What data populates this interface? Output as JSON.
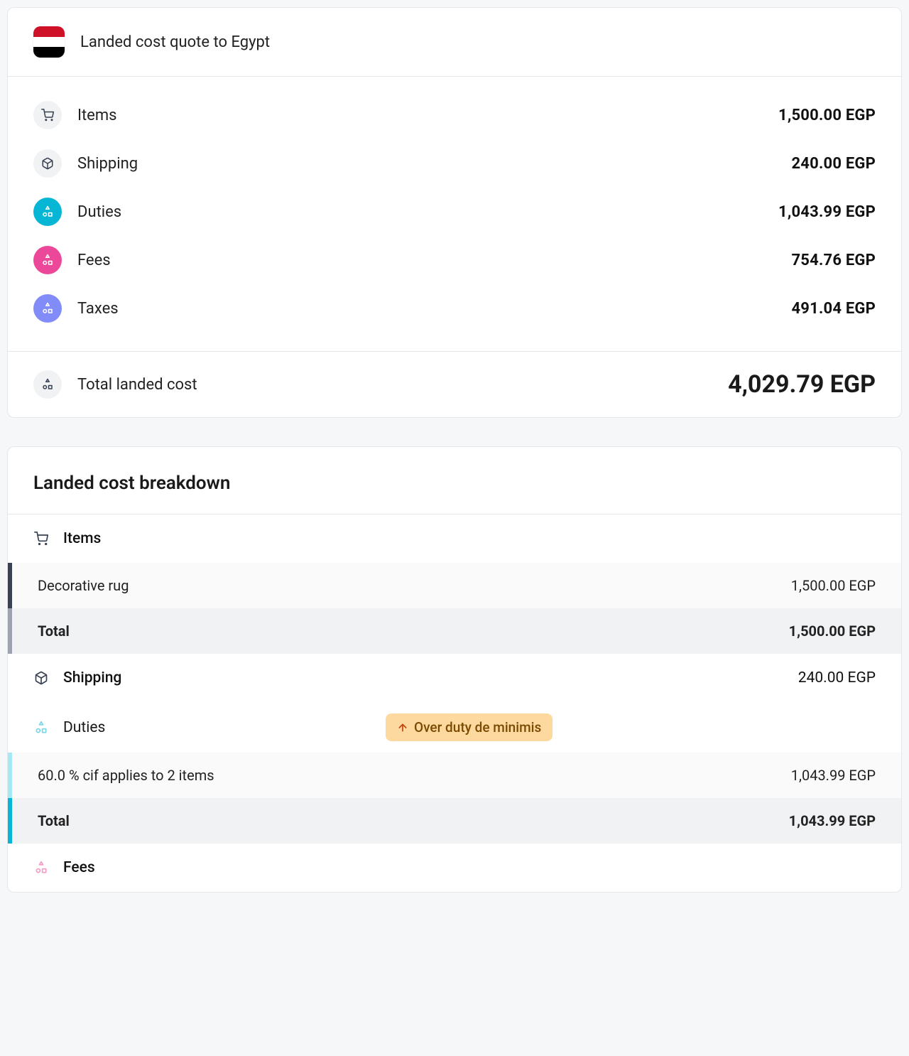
{
  "quote": {
    "title": "Landed cost quote to Egypt",
    "country_flag": "egypt",
    "summary": {
      "items": {
        "label": "Items",
        "value": "1,500.00 EGP"
      },
      "shipping": {
        "label": "Shipping",
        "value": "240.00 EGP"
      },
      "duties": {
        "label": "Duties",
        "value": "1,043.99 EGP"
      },
      "fees": {
        "label": "Fees",
        "value": "754.76 EGP"
      },
      "taxes": {
        "label": "Taxes",
        "value": "491.04 EGP"
      }
    },
    "total": {
      "label": "Total landed cost",
      "value": "4,029.79 EGP"
    }
  },
  "breakdown": {
    "title": "Landed cost breakdown",
    "items_section": {
      "heading": "Items",
      "rows": [
        {
          "name": "Decorative rug",
          "value": "1,500.00 EGP"
        }
      ],
      "total": {
        "name": "Total",
        "value": "1,500.00 EGP"
      }
    },
    "shipping_section": {
      "heading": "Shipping",
      "value": "240.00 EGP"
    },
    "duties_section": {
      "heading": "Duties",
      "badge": "Over duty de minimis",
      "rows": [
        {
          "name": "60.0 % cif applies to 2 items",
          "value": "1,043.99 EGP"
        }
      ],
      "total": {
        "name": "Total",
        "value": "1,043.99 EGP"
      }
    },
    "fees_section": {
      "heading": "Fees"
    }
  }
}
